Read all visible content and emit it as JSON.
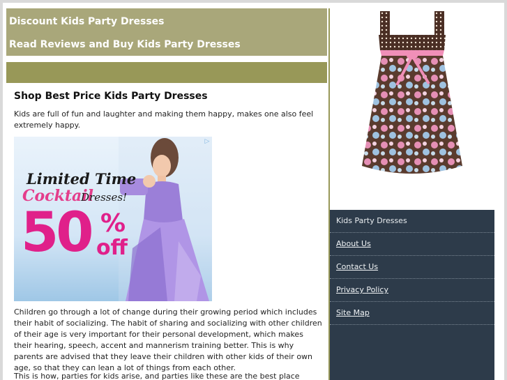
{
  "header": {
    "title": "Discount Kids Party Dresses",
    "subtitle": "Read Reviews and Buy Kids Party Dresses"
  },
  "content": {
    "heading": "Shop Best Price Kids Party Dresses",
    "intro": "Kids are full of fun and laughter and making them happy, makes one also feel extremely happy.",
    "ad": {
      "line1": "Limited Time",
      "line2a": "Cocktail",
      "line2b": "Dresses!",
      "discount": "50",
      "percent": "%",
      "off": "off"
    },
    "paragraph1": "Children go through a lot of change during their growing period which includes their habit of socializing. The habit of sharing and socializing with other children of their age is very important for their personal development, which makes their hearing, speech, accent and mannerism training better. This is why parents are advised that they leave their children with other kids of their own age, so that they can lean a lot of things from each other.",
    "paragraph2": "This is how, parties for kids arise, and parties like these are the best place where children"
  },
  "sidebar": {
    "items": [
      {
        "label": "Kids Party Dresses"
      },
      {
        "label": "About Us"
      },
      {
        "label": "Contact Us"
      },
      {
        "label": "Privacy Policy"
      },
      {
        "label": "Site Map"
      }
    ]
  },
  "colors": {
    "header_bg": "#a9a77a",
    "nav_bg": "#989858",
    "sidebar_bg": "#2d3b4a",
    "ad_pink": "#e0208a"
  }
}
